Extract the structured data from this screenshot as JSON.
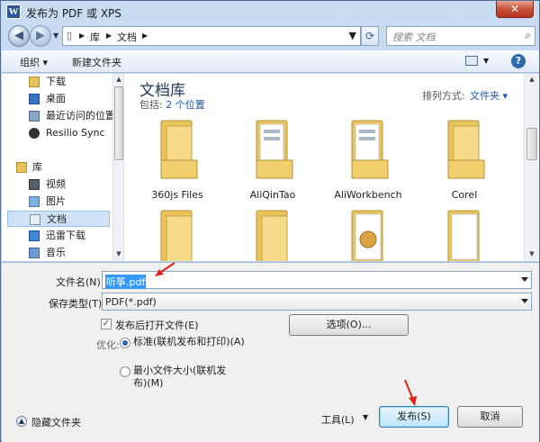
{
  "window": {
    "title": "发布为 PDF 或 XPS",
    "app_icon": "W",
    "close_glyph": "✕"
  },
  "nav": {
    "back_glyph": "◀",
    "forward_glyph": "▶",
    "breadcrumb": [
      "库",
      "文档"
    ],
    "search_placeholder": "搜索 文档",
    "refresh_glyph": "⟳"
  },
  "toolbar": {
    "organize": "组织 ▾",
    "new_folder": "新建文件夹"
  },
  "sidebar": {
    "items": [
      {
        "label": "下载",
        "icon": "download-folder-icon"
      },
      {
        "label": "桌面",
        "icon": "desktop-icon"
      },
      {
        "label": "最近访问的位置",
        "icon": "recent-places-icon"
      },
      {
        "label": "Resilio Sync",
        "icon": "resilio-sync-icon"
      },
      {
        "label": "库",
        "icon": "libraries-icon"
      },
      {
        "label": "视频",
        "icon": "videos-icon"
      },
      {
        "label": "图片",
        "icon": "pictures-icon"
      },
      {
        "label": "文档",
        "icon": "documents-icon"
      },
      {
        "label": "迅雷下载",
        "icon": "xunlei-download-icon"
      },
      {
        "label": "音乐",
        "icon": "music-icon"
      }
    ]
  },
  "library": {
    "title": "文档库",
    "includes_label": "包括:",
    "includes_link": "2 个位置",
    "sort_label": "排列方式:",
    "sort_value": "文件夹 ▾"
  },
  "folders": [
    {
      "label": "360js Files"
    },
    {
      "label": "AliQinTao"
    },
    {
      "label": "AliWorkbench"
    },
    {
      "label": "Corel"
    },
    {
      "label": ""
    },
    {
      "label": ""
    },
    {
      "label": ""
    },
    {
      "label": ""
    }
  ],
  "form": {
    "filename_label": "文件名(N):",
    "filename_value": "听筝.pdf",
    "savetype_label": "保存类型(T):",
    "savetype_value": "PDF(*.pdf)",
    "open_after_label": "发布后打开文件(E)",
    "open_after_checked": true,
    "options_button": "选项(O)...",
    "optimize_label": "优化:",
    "radio_standard": "标准(联机发布和打印)(A)",
    "radio_minimum": "最小文件大小(联机发布)(M)",
    "hide_folders": "隐藏文件夹",
    "tools_button": "工具(L)",
    "publish_button": "发布(S)",
    "cancel_button": "取消"
  }
}
